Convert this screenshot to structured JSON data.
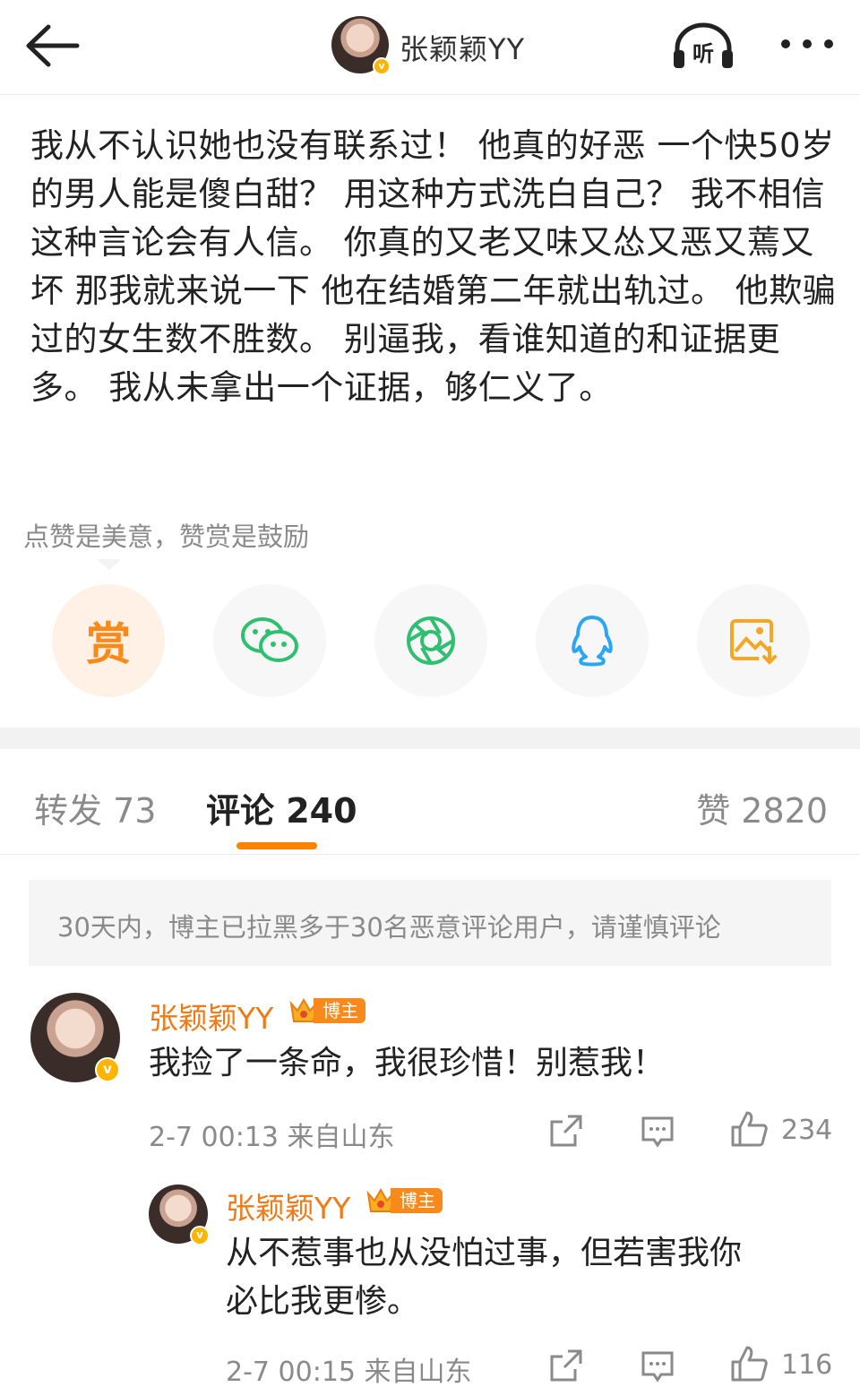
{
  "header": {
    "username": "张颖颖YY",
    "back_icon": "arrow-left-icon",
    "listen_label": "听",
    "more_icon": "more-dots-icon"
  },
  "post": {
    "text": "我从不认识她也没有联系过！ 他真的好恶 一个快50岁的男人能是傻白甜？ 用这种方式洗白自己？ 我不相信这种言论会有人信。 你真的又老又味又怂又恶又蔫又坏 那我就来说一下 他在结婚第二年就出轨过。 他欺骗过的女生数不胜数。 别逼我，看谁知道的和证据更多。 我从未拿出一个证据，够仁义了。"
  },
  "reward": {
    "tip": "点赞是美意，赞赏是鼓励",
    "reward_label": "赏"
  },
  "share_icons": [
    "reward-icon",
    "wechat-icon",
    "moments-icon",
    "qq-icon",
    "save-image-icon"
  ],
  "tabs": {
    "repost": "转发 73",
    "comments": "评论 240",
    "likes": "赞 2820"
  },
  "notice": "30天内，博主已拉黑多于30名恶意评论用户，请谨慎评论",
  "comments": [
    {
      "name": "张颖颖YY",
      "badge": "博主",
      "text": "我捡了一条命，我很珍惜！别惹我！",
      "meta": "2-7 00:13 来自山东",
      "likes": "234"
    },
    {
      "name": "张颖颖YY",
      "badge": "博主",
      "text_line1": "从不惹事也从没怕过事，但若害我你",
      "text_line2": "必比我更惨。",
      "meta": "2-7 00:15 来自山东",
      "likes": "116"
    }
  ],
  "colors": {
    "accent": "#ff8200",
    "name_orange": "#f07a16",
    "muted": "#8a8a8a",
    "wechat_green": "#2fbf71",
    "qq_blue": "#2aa6f5"
  }
}
